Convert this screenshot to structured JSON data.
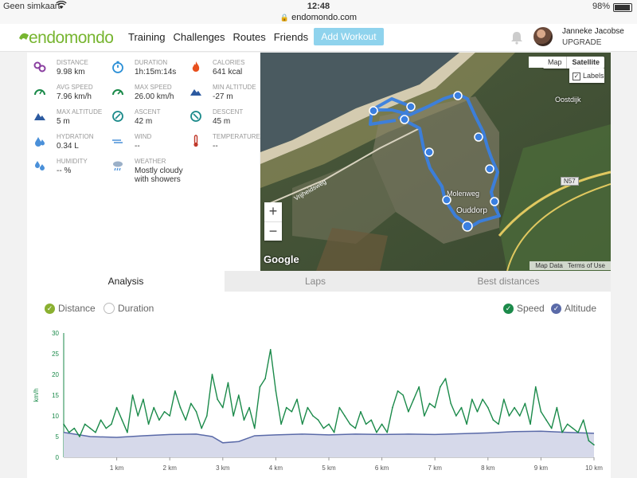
{
  "status_bar": {
    "carrier": "Geen simkaart",
    "time": "12:48",
    "battery": "98%"
  },
  "browser": {
    "url": "endomondo.com"
  },
  "header": {
    "logo": "endomondo",
    "nav": [
      "Training",
      "Challenges",
      "Routes",
      "Friends"
    ],
    "add_workout": "Add Workout",
    "username": "Janneke Jacobse",
    "upgrade": "UPGRADE"
  },
  "stats": [
    {
      "label": "DISTANCE",
      "value": "9.98 km",
      "icon": "distance-icon",
      "color": "#8a3fa0"
    },
    {
      "label": "DURATION",
      "value": "1h:15m:14s",
      "icon": "stopwatch-icon",
      "color": "#2b8fd6"
    },
    {
      "label": "CALORIES",
      "value": "641 kcal",
      "icon": "flame-icon",
      "color": "#e8501e"
    },
    {
      "label": "AVG SPEED",
      "value": "7.96 km/h",
      "icon": "speedometer-icon",
      "color": "#1b8a4a"
    },
    {
      "label": "MAX SPEED",
      "value": "26.00 km/h",
      "icon": "speedometer-icon",
      "color": "#1b8a4a"
    },
    {
      "label": "MIN ALTITUDE",
      "value": "-27 m",
      "icon": "mountain-icon",
      "color": "#2c5aa0"
    },
    {
      "label": "MAX ALTITUDE",
      "value": "5 m",
      "icon": "mountain-icon",
      "color": "#2c5aa0"
    },
    {
      "label": "ASCENT",
      "value": "42 m",
      "icon": "ascent-icon",
      "color": "#1b8a8a"
    },
    {
      "label": "DESCENT",
      "value": "45 m",
      "icon": "descent-icon",
      "color": "#1b8a8a"
    },
    {
      "label": "HYDRATION",
      "value": "0.34 L",
      "icon": "water-drop-icon",
      "color": "#4a90d9"
    },
    {
      "label": "WIND",
      "value": "--",
      "icon": "wind-icon",
      "color": "#4a90d9"
    },
    {
      "label": "TEMPERATURE",
      "value": "--",
      "icon": "thermometer-icon",
      "color": "#c0392b"
    },
    {
      "label": "HUMIDITY",
      "value": "-- %",
      "icon": "humidity-icon",
      "color": "#4a90d9"
    },
    {
      "label": "WEATHER",
      "value": "Mostly cloudy with showers",
      "icon": "cloud-rain-icon",
      "color": "#9bb0c8"
    }
  ],
  "map": {
    "type_map": "Map",
    "type_satellite": "Satellite",
    "labels": "Labels",
    "zoom_in": "+",
    "zoom_out": "−",
    "google": "Google",
    "map_data": "Map Data",
    "terms": "Terms of Use",
    "places": [
      "Oostdijk",
      "Vrijheidsweg",
      "Molenweg",
      "Ouddorp",
      "N57"
    ],
    "markers": [
      "1",
      "2",
      "3",
      "4",
      "5",
      "6",
      "7",
      "8",
      "9"
    ]
  },
  "tabs": [
    {
      "label": "Analysis",
      "active": true
    },
    {
      "label": "Laps",
      "active": false
    },
    {
      "label": "Best distances",
      "active": false
    }
  ],
  "toggles": {
    "distance": "Distance",
    "duration": "Duration",
    "speed": "Speed",
    "altitude": "Altitude"
  },
  "chart_data": {
    "type": "line",
    "xlabel": "",
    "ylabel": "km/h",
    "xlim": [
      0,
      10
    ],
    "ylim": [
      0,
      30
    ],
    "yticks": [
      0,
      5,
      10,
      15,
      20,
      25,
      30
    ],
    "xticks": [
      "1 km",
      "2 km",
      "3 km",
      "4 km",
      "5 km",
      "6 km",
      "7 km",
      "8 km",
      "9 km",
      "10 km"
    ],
    "grid": false,
    "series": [
      {
        "name": "Speed",
        "color": "#1b8a4a",
        "x": [
          0.0,
          0.1,
          0.2,
          0.3,
          0.4,
          0.5,
          0.6,
          0.7,
          0.8,
          0.9,
          1.0,
          1.1,
          1.2,
          1.3,
          1.4,
          1.5,
          1.6,
          1.7,
          1.8,
          1.9,
          2.0,
          2.1,
          2.2,
          2.3,
          2.4,
          2.5,
          2.6,
          2.7,
          2.8,
          2.9,
          3.0,
          3.1,
          3.2,
          3.3,
          3.4,
          3.5,
          3.6,
          3.7,
          3.8,
          3.9,
          4.0,
          4.1,
          4.2,
          4.3,
          4.4,
          4.5,
          4.6,
          4.7,
          4.8,
          4.9,
          5.0,
          5.1,
          5.2,
          5.3,
          5.4,
          5.5,
          5.6,
          5.7,
          5.8,
          5.9,
          6.0,
          6.1,
          6.2,
          6.3,
          6.4,
          6.5,
          6.6,
          6.7,
          6.8,
          6.9,
          7.0,
          7.1,
          7.2,
          7.3,
          7.4,
          7.5,
          7.6,
          7.7,
          7.8,
          7.9,
          8.0,
          8.1,
          8.2,
          8.3,
          8.4,
          8.5,
          8.6,
          8.7,
          8.8,
          8.9,
          9.0,
          9.1,
          9.2,
          9.3,
          9.4,
          9.5,
          9.6,
          9.7,
          9.8,
          9.9,
          10.0
        ],
        "values": [
          8,
          6,
          7,
          5,
          8,
          7,
          6,
          9,
          7,
          8,
          12,
          9,
          6,
          15,
          10,
          14,
          8,
          12,
          9,
          11,
          10,
          16,
          12,
          9,
          13,
          11,
          7,
          10,
          20,
          14,
          12,
          18,
          10,
          15,
          9,
          12,
          7,
          17,
          19,
          26,
          16,
          8,
          12,
          11,
          14,
          8,
          12,
          10,
          9,
          7,
          8,
          6,
          12,
          10,
          8,
          7,
          11,
          8,
          9,
          6,
          8,
          6,
          12,
          16,
          15,
          11,
          14,
          17,
          10,
          13,
          12,
          17,
          19,
          13,
          10,
          12,
          8,
          14,
          11,
          14,
          12,
          9,
          8,
          14,
          10,
          12,
          10,
          13,
          8,
          17,
          11,
          9,
          7,
          12,
          6,
          8,
          7,
          6,
          9,
          4,
          3
        ]
      },
      {
        "name": "Altitude",
        "color": "#5a6aa8",
        "x": [
          0,
          0.5,
          1.0,
          1.5,
          2.0,
          2.5,
          2.8,
          3.0,
          3.3,
          3.6,
          4.0,
          4.5,
          5.0,
          5.5,
          6.0,
          6.5,
          7.0,
          7.5,
          8.0,
          8.5,
          9.0,
          9.5,
          10.0
        ],
        "values": [
          6,
          5,
          4.8,
          5.2,
          5.5,
          5.6,
          5,
          3.5,
          3.8,
          5.2,
          5.4,
          5.6,
          5.4,
          5.6,
          5.5,
          5.6,
          5.5,
          5.7,
          5.9,
          6.2,
          6.3,
          6.0,
          5.8
        ]
      }
    ]
  }
}
